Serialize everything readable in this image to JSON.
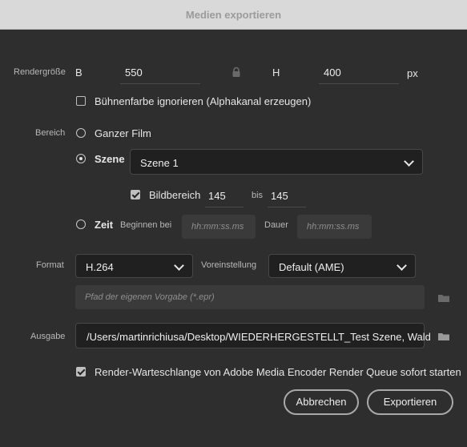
{
  "window": {
    "title": "Medien exportieren"
  },
  "render_size": {
    "label": "Rendergröße",
    "w_label": "B",
    "w_value": "550",
    "h_label": "H",
    "h_value": "400",
    "unit": "px"
  },
  "ignore_stage_color": {
    "label": "Bühnenfarbe ignorieren (Alphakanal erzeugen)",
    "checked": false
  },
  "range": {
    "label": "Bereich",
    "whole_movie": "Ganzer Film",
    "scene": "Szene",
    "scene_select": "Szene 1",
    "frame_range_label": "Bildbereich",
    "frame_from": "145",
    "frame_to_label": "bis",
    "frame_to": "145",
    "time": "Zeit",
    "begin_label": "Beginnen bei",
    "begin_placeholder": "hh:mm:ss.ms",
    "duration_label": "Dauer",
    "duration_placeholder": "hh:mm:ss.ms",
    "selected": "scene"
  },
  "format": {
    "label": "Format",
    "value": "H.264",
    "preset_label": "Voreinstellung",
    "preset_value": "Default (AME)",
    "custom_preset_placeholder": "Pfad der eigenen Vorgabe (*.epr)"
  },
  "output": {
    "label": "Ausgabe",
    "path": "/Users/martinrichiusa/Desktop/WIEDERHERGESTELLT_Test Szene, Wald"
  },
  "queue": {
    "label": "Render-Warteschlange von Adobe Media Encoder Render Queue sofort starten",
    "checked": true
  },
  "buttons": {
    "cancel": "Abbrechen",
    "export": "Exportieren"
  }
}
